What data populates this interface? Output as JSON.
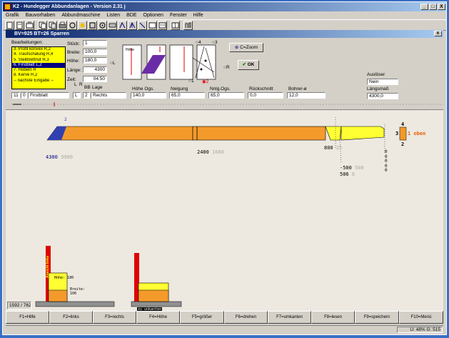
{
  "window": {
    "title": "K2 - Hundegger Abbundanlagen - Version 2.31 j",
    "controls": [
      "_",
      "□",
      "X"
    ]
  },
  "menu": [
    "Grafik",
    "Bauvorhaben",
    "Abbundmaschine",
    "Listen",
    "BDE",
    "Optionen",
    "Fenster",
    "Hilfe"
  ],
  "subwindow": {
    "title": "BV=925  BT=26 Sparren",
    "close": "x"
  },
  "bearbeitungen": {
    "label": "Bearbeitungen:",
    "items": [
      "3. Profil konvex R,2",
      "4. Traufschalung R,4",
      "5. Stellbrettnut R,3",
      "6. Firstblatt L,2",
      "7. Hobeln R",
      "8. Kerve R,2",
      "-- nächste Eingabe --"
    ],
    "selected_index": 3
  },
  "dims": {
    "stueck_label": "Stück:",
    "stueck": "1",
    "breite_label": "Breite:",
    "breite": "100,0",
    "hoehe_label": "Höhe:",
    "hoehe": "180,0",
    "laenge_label": "Länge:",
    "laenge": "4300",
    "zeit_label": "Zeit:",
    "zeit": "04:50"
  },
  "preview": {
    "hoehe_label": "Höhe",
    "side_label": "L"
  },
  "radios": {
    "r4": "4",
    "r3": "3",
    "r1": "1",
    "r2": "2",
    "rR": "R",
    "rL": "L"
  },
  "buttons": {
    "zoom": "C=Zoom",
    "ok": "OK"
  },
  "ausloeser": {
    "label": "Auslöser",
    "value": "Nein"
  },
  "laengsmass": {
    "label": "Längsmaß",
    "value": "4300,0"
  },
  "row": {
    "headers": {
      "l": "L",
      "r": "R",
      "bb": "BB",
      "lage": "Lage",
      "hoehe_ogs": "Höhe Ogs.",
      "neigung": "Neigung",
      "nnlg": "Nnlg.Ogs.",
      "rueckschnitt": "Rückschnitt",
      "bohrer": "Bohrer-ø"
    },
    "values": {
      "idx": "11",
      "n": "0",
      "name": "Firstblatt",
      "lr": "L",
      "bb": "2",
      "lage": "Rechts",
      "hoehe_ogs": "140,0",
      "neigung": "65,0",
      "nnlg": "65,0",
      "rueckschnitt": "0,0",
      "bohrer": "12,0"
    }
  },
  "beam": {
    "start_label": "4300",
    "start_label_dim": "3900",
    "mid_label": "2400",
    "mid_label_dim": "1600",
    "right_label": "800",
    "right_label_dim": "25",
    "right_sub1": "-500",
    "right_sub1_dim": "500",
    "right_sub2": "506",
    "right_sub2_dim": "6",
    "end_col": [
      "0",
      "0",
      "0",
      "0",
      "0"
    ],
    "side_top": "4",
    "side_left": "3",
    "side_bottom": "2",
    "oben": "1 oben",
    "start_marker": "2"
  },
  "cross_section": {
    "left_tag": "Ansicht links",
    "hoehe": "Höhe: 180",
    "breite": "Breite:",
    "breite_val": "100",
    "right_tag": "zu unkanten",
    "counter": "1592 / 762"
  },
  "fkeys": [
    "F1=Hilfe",
    "F2=links",
    "F3=rechts",
    "F4=Höhe",
    "F5=größer",
    "F6=drehen",
    "F7=umkanten",
    "F8=lesen",
    "F9=speichern",
    "F10=Menü"
  ],
  "status": "U: 48% G: 515",
  "colors": {
    "beam": "#f39a2b",
    "beam_end": "#ffff33",
    "marker": "#e00000",
    "list_bg": "#ffff00",
    "title": "#0a246a"
  }
}
